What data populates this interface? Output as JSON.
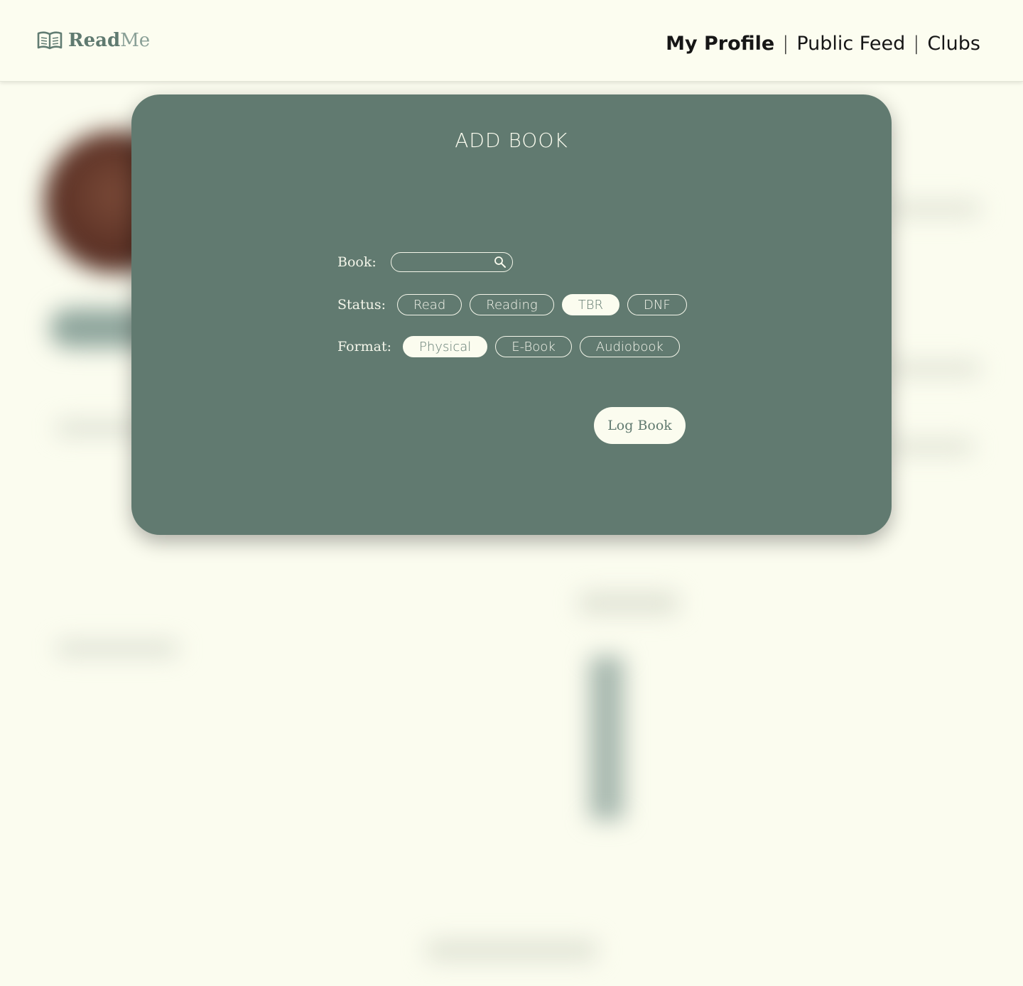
{
  "header": {
    "logo_text_read": "Read",
    "logo_text_me": "Me",
    "logo_icon": "open-book-icon",
    "nav": [
      {
        "label": "My Profile",
        "active": true
      },
      {
        "label": "Public Feed",
        "active": false
      },
      {
        "label": "Clubs",
        "active": false
      }
    ],
    "separator": "|"
  },
  "modal": {
    "title": "ADD BOOK",
    "book_label": "Book:",
    "book_input_value": "",
    "book_search_icon": "search-icon",
    "status_label": "Status:",
    "status_options": [
      {
        "label": "Read",
        "selected": false
      },
      {
        "label": "Reading",
        "selected": false
      },
      {
        "label": "TBR",
        "selected": true
      },
      {
        "label": "DNF",
        "selected": false
      }
    ],
    "format_label": "Format:",
    "format_options": [
      {
        "label": "Physical",
        "selected": true
      },
      {
        "label": "E-Book",
        "selected": false
      },
      {
        "label": "Audiobook",
        "selected": false
      }
    ],
    "submit_label": "Log Book"
  },
  "colors": {
    "page_background": "#fbfcef",
    "modal_background": "#617a70",
    "accent": "#617a70",
    "chip_selected_bg": "#fbfcef"
  }
}
